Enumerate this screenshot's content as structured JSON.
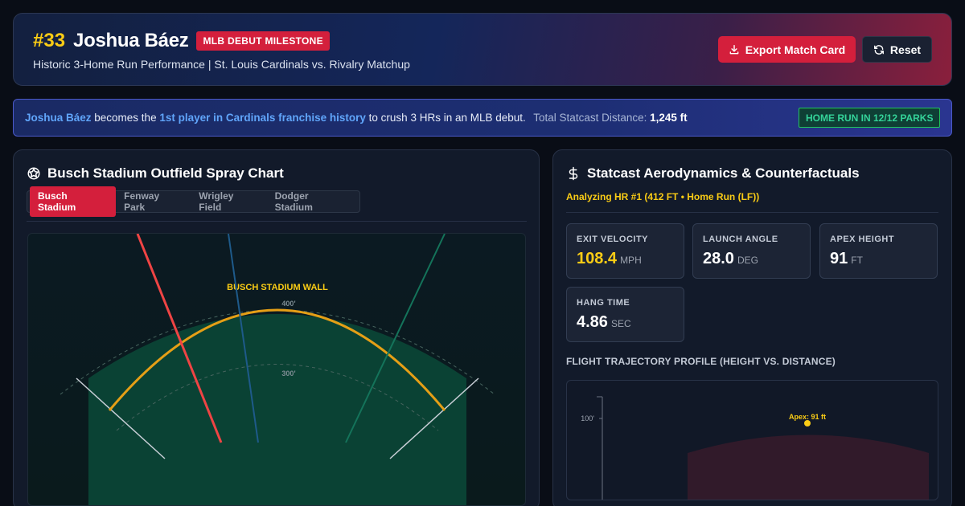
{
  "header": {
    "jersey": "#33",
    "player_name": "Joshua Báez",
    "milestone_badge": "MLB DEBUT MILESTONE",
    "subtitle": "Historic 3-Home Run Performance | St. Louis Cardinals vs. Rivalry Matchup",
    "export_label": "Export Match Card",
    "reset_label": "Reset"
  },
  "banner": {
    "name": "Joshua Báez",
    "text1": " becomes the ",
    "highlight": "1st player in Cardinals franchise history",
    "text2": " to crush 3 HRs in an MLB debut.",
    "distance_label": " Total Statcast Distance: ",
    "distance_value": "1,245 ft",
    "parks_badge": "HOME RUN IN 12/12 PARKS"
  },
  "spray": {
    "title": "Busch Stadium Outfield Spray Chart",
    "tabs": [
      "Busch Stadium",
      "Fenway Park",
      "Wrigley Field",
      "Dodger Stadium"
    ],
    "active_tab": 0,
    "wall_label": "BUSCH STADIUM WALL",
    "ring_labels": [
      "400'",
      "300'"
    ]
  },
  "statcast": {
    "title": "Statcast Aerodynamics & Counterfactuals",
    "analyzing": "Analyzing HR #1 (412 FT • Home Run (LF))",
    "stats": [
      {
        "label": "EXIT VELOCITY",
        "value": "108.4",
        "unit": "MPH"
      },
      {
        "label": "LAUNCH ANGLE",
        "value": "28.0",
        "unit": "DEG"
      },
      {
        "label": "APEX HEIGHT",
        "value": "91",
        "unit": "FT"
      },
      {
        "label": "HANG TIME",
        "value": "4.86",
        "unit": "SEC"
      }
    ],
    "trajectory_title": "FLIGHT TRAJECTORY PROFILE (HEIGHT VS. DISTANCE)",
    "trajectory_y_tick": "100'",
    "apex_label": "Apex: 91 ft"
  },
  "colors": {
    "accent_red": "#d41f3c",
    "gold": "#facc15",
    "blue_highlight": "#60a5fa",
    "badge_green": "#34d399"
  }
}
